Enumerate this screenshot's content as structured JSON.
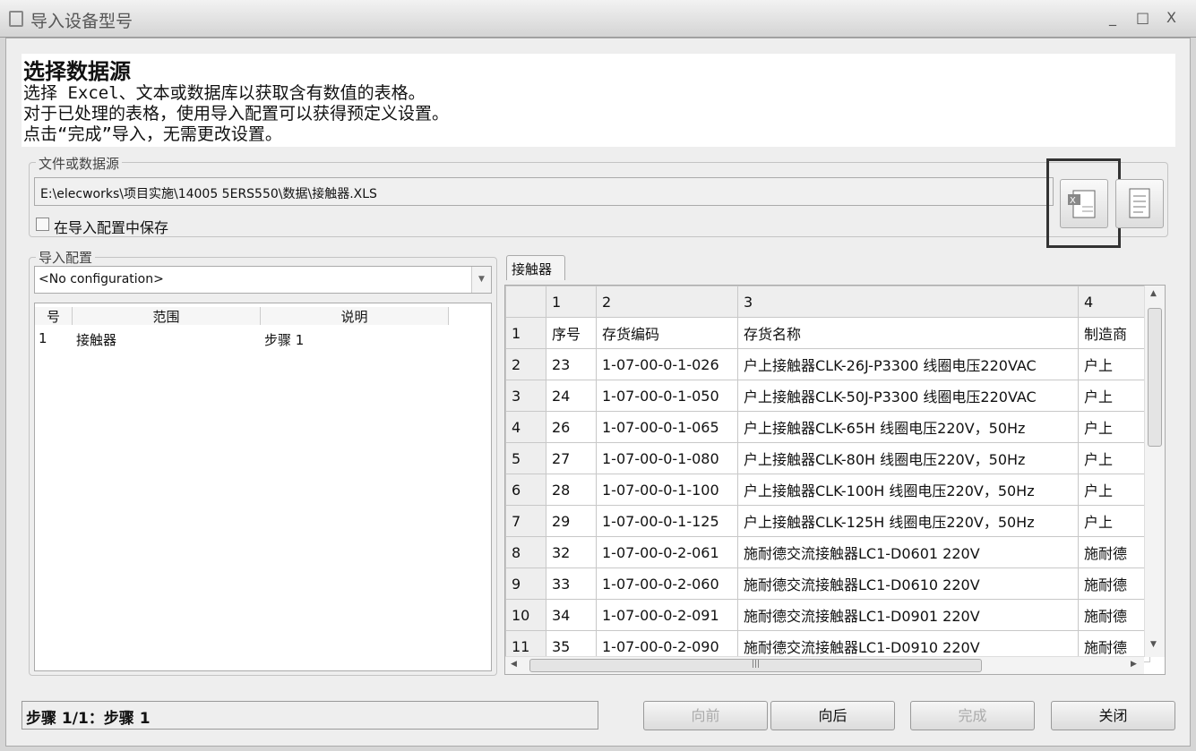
{
  "window": {
    "title": "导入设备型号",
    "minimize": "_",
    "maximize": "□",
    "close": "X"
  },
  "header": {
    "title": "选择数据源",
    "lines": [
      "选择 Excel、文本或数据库以获取含有数值的表格。",
      "对于已处理的表格，使用导入配置可以获得预定义设置。",
      "点击“完成”导入，无需更改设置。"
    ]
  },
  "source": {
    "group_label": "文件或数据源",
    "path": "E:\\elecworks\\项目实施\\14005 5ERS550\\数据\\接触器.XLS",
    "save_label": "在导入配置中保存"
  },
  "config": {
    "group_label": "导入配置",
    "selected": "<No configuration>",
    "columns": [
      "号",
      "范围",
      "说明"
    ],
    "rows": [
      [
        "1",
        "接触器",
        "步骤 1"
      ]
    ]
  },
  "sheet": {
    "tab": "接触器",
    "col_headers": [
      "1",
      "2",
      "3",
      "4"
    ],
    "rows": [
      [
        "1",
        "序号",
        "存货编码",
        "存货名称",
        "制造商"
      ],
      [
        "2",
        "23",
        "1-07-00-0-1-026",
        "户上接触器CLK-26J-P3300  线圈电压220VAC",
        "户上"
      ],
      [
        "3",
        "24",
        "1-07-00-0-1-050",
        "户上接触器CLK-50J-P3300  线圈电压220VAC",
        "户上"
      ],
      [
        "4",
        "26",
        "1-07-00-0-1-065",
        "户上接触器CLK-65H     线圈电压220V，50Hz",
        "户上"
      ],
      [
        "5",
        "27",
        "1-07-00-0-1-080",
        "户上接触器CLK-80H     线圈电压220V，50Hz",
        "户上"
      ],
      [
        "6",
        "28",
        "1-07-00-0-1-100",
        "户上接触器CLK-100H     线圈电压220V，50Hz",
        "户上"
      ],
      [
        "7",
        "29",
        "1-07-00-0-1-125",
        "户上接触器CLK-125H     线圈电压220V，50Hz",
        "户上"
      ],
      [
        "8",
        "32",
        "1-07-00-0-2-061",
        "施耐德交流接触器LC1-D0601 220V",
        "施耐德"
      ],
      [
        "9",
        "33",
        "1-07-00-0-2-060",
        "施耐德交流接触器LC1-D0610 220V",
        "施耐德"
      ],
      [
        "10",
        "34",
        "1-07-00-0-2-091",
        "施耐德交流接触器LC1-D0901 220V",
        "施耐德"
      ],
      [
        "11",
        "35",
        "1-07-00-0-2-090",
        "施耐德交流接触器LC1-D0910 220V",
        "施耐德"
      ]
    ]
  },
  "footer": {
    "status": "步骤 1/1：步骤 1",
    "prev": "向前",
    "next": "向后",
    "finish": "完成",
    "close": "关闭"
  }
}
